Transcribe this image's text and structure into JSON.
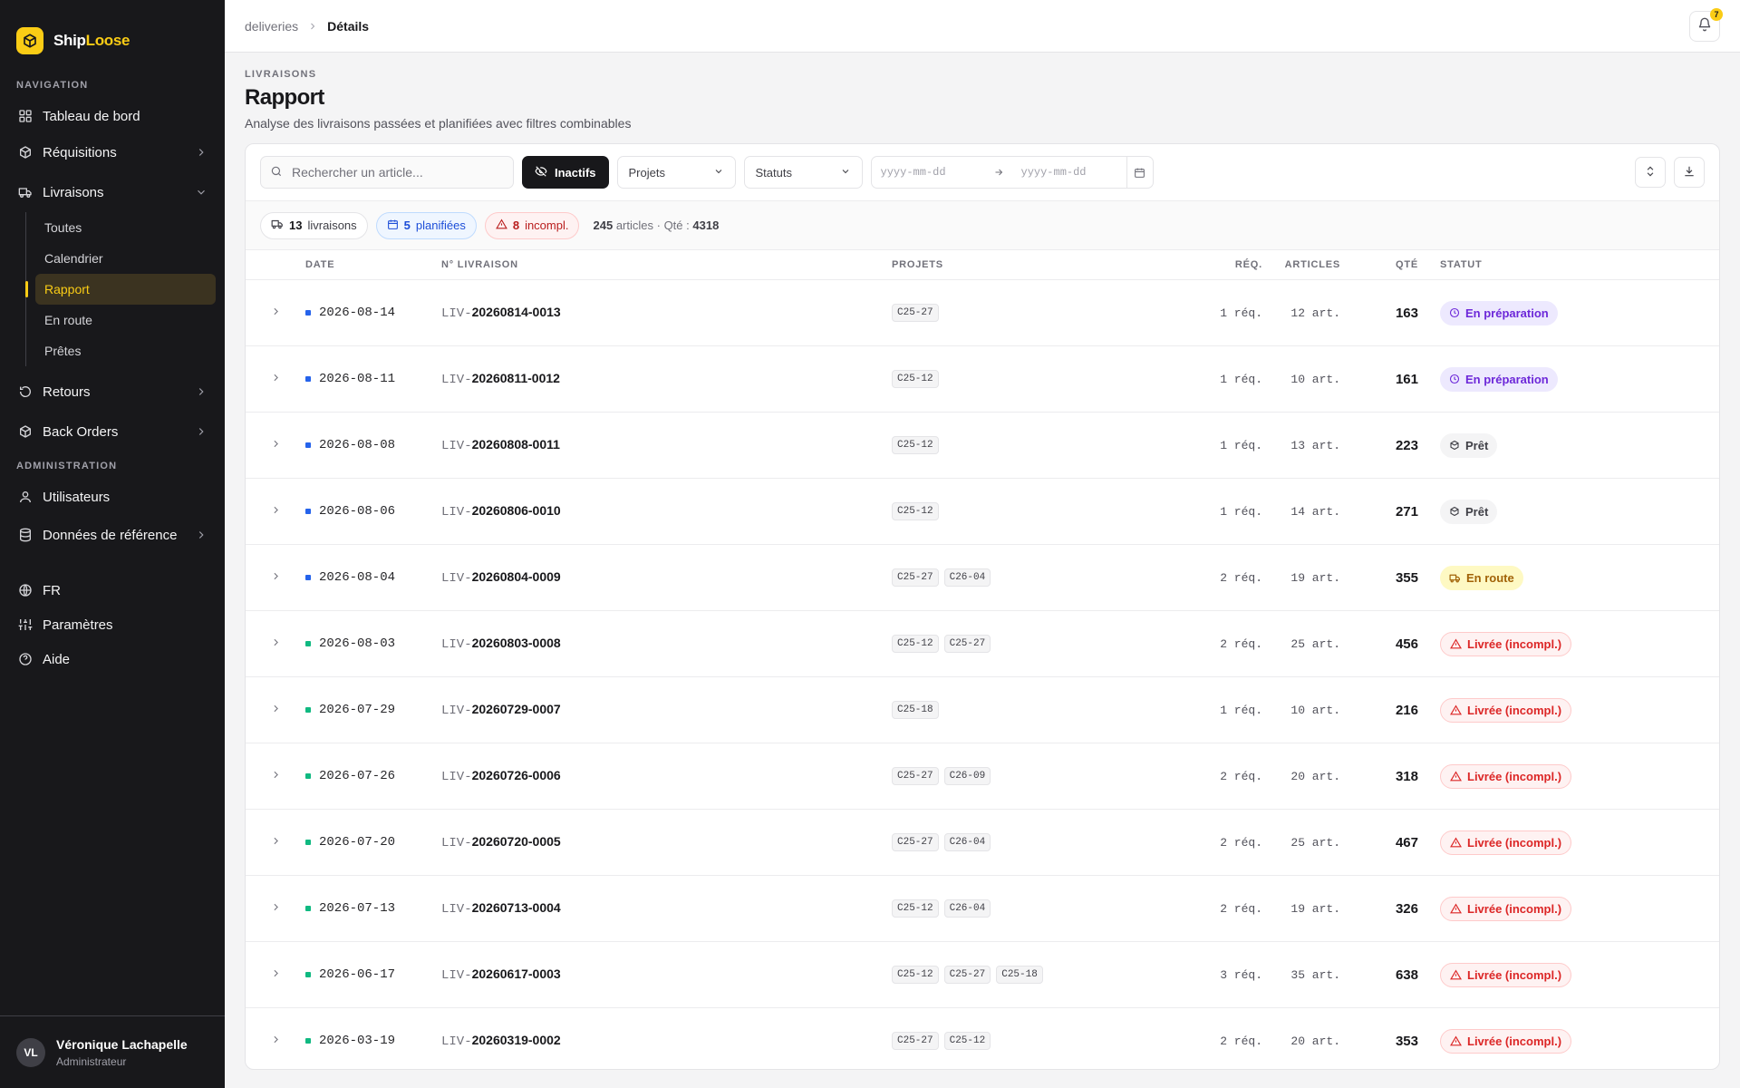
{
  "brand": {
    "name_part1": "Ship",
    "name_part2": "Loose"
  },
  "sidebar": {
    "nav_label": "NAVIGATION",
    "items": [
      {
        "label": "Tableau de bord"
      },
      {
        "label": "Réquisitions"
      },
      {
        "label": "Livraisons"
      }
    ],
    "livraisons_sub": [
      "Toutes",
      "Calendrier",
      "Rapport",
      "En route",
      "Prêtes"
    ],
    "items_after": [
      {
        "label": "Retours"
      },
      {
        "label": "Back Orders"
      }
    ],
    "admin_label": "ADMINISTRATION",
    "admin_items": [
      {
        "label": "Utilisateurs"
      },
      {
        "label": "Données de référence"
      }
    ],
    "bottom_items": [
      {
        "label": "FR"
      },
      {
        "label": "Paramètres"
      },
      {
        "label": "Aide"
      }
    ],
    "user": {
      "initials": "VL",
      "name": "Véronique Lachapelle",
      "role": "Administrateur"
    }
  },
  "topbar": {
    "breadcrumb_parent": "deliveries",
    "breadcrumb_current": "Détails",
    "notifications_count": "7"
  },
  "header": {
    "eyebrow": "LIVRAISONS",
    "title": "Rapport",
    "subtitle": "Analyse des livraisons passées et planifiées avec filtres combinables"
  },
  "toolbar": {
    "search_placeholder": "Rechercher un article...",
    "inactive_label": "Inactifs",
    "projects_label": "Projets",
    "status_label": "Statuts",
    "date_from_placeholder": "yyyy-mm-dd",
    "date_to_placeholder": "yyyy-mm-dd"
  },
  "stats": {
    "deliveries_count": "13",
    "deliveries_label": "livraisons",
    "planned_count": "5",
    "planned_label": "planifiées",
    "incomplete_count": "8",
    "incomplete_label": "incompl.",
    "articles_count": "245",
    "articles_label": "articles",
    "qty_label": "Qté :",
    "qty_value": "4318"
  },
  "table": {
    "headers": {
      "date": "DATE",
      "number": "N° LIVRAISON",
      "projects": "PROJETS",
      "req": "RÉQ.",
      "articles": "ARTICLES",
      "qty": "QTÉ",
      "status": "STATUT"
    },
    "rows": [
      {
        "date": "2026-08-14",
        "prefix": "LIV-",
        "id": "20260814-0013",
        "projects": [
          "C25-27"
        ],
        "req": "1 réq.",
        "articles": "12 art.",
        "qty": "163",
        "status": "En préparation",
        "kind": "prep",
        "planned": true
      },
      {
        "date": "2026-08-11",
        "prefix": "LIV-",
        "id": "20260811-0012",
        "projects": [
          "C25-12"
        ],
        "req": "1 réq.",
        "articles": "10 art.",
        "qty": "161",
        "status": "En préparation",
        "kind": "prep",
        "planned": true
      },
      {
        "date": "2026-08-08",
        "prefix": "LIV-",
        "id": "20260808-0011",
        "projects": [
          "C25-12"
        ],
        "req": "1 réq.",
        "articles": "13 art.",
        "qty": "223",
        "status": "Prêt",
        "kind": "pret",
        "planned": true
      },
      {
        "date": "2026-08-06",
        "prefix": "LIV-",
        "id": "20260806-0010",
        "projects": [
          "C25-12"
        ],
        "req": "1 réq.",
        "articles": "14 art.",
        "qty": "271",
        "status": "Prêt",
        "kind": "pret",
        "planned": true
      },
      {
        "date": "2026-08-04",
        "prefix": "LIV-",
        "id": "20260804-0009",
        "projects": [
          "C25-27",
          "C26-04"
        ],
        "req": "2 réq.",
        "articles": "19 art.",
        "qty": "355",
        "status": "En route",
        "kind": "route",
        "planned": true
      },
      {
        "date": "2026-08-03",
        "prefix": "LIV-",
        "id": "20260803-0008",
        "projects": [
          "C25-12",
          "C25-27"
        ],
        "req": "2 réq.",
        "articles": "25 art.",
        "qty": "456",
        "status": "Livrée (incompl.)",
        "kind": "inc",
        "planned": false
      },
      {
        "date": "2026-07-29",
        "prefix": "LIV-",
        "id": "20260729-0007",
        "projects": [
          "C25-18"
        ],
        "req": "1 réq.",
        "articles": "10 art.",
        "qty": "216",
        "status": "Livrée (incompl.)",
        "kind": "inc",
        "planned": false
      },
      {
        "date": "2026-07-26",
        "prefix": "LIV-",
        "id": "20260726-0006",
        "projects": [
          "C25-27",
          "C26-09"
        ],
        "req": "2 réq.",
        "articles": "20 art.",
        "qty": "318",
        "status": "Livrée (incompl.)",
        "kind": "inc",
        "planned": false
      },
      {
        "date": "2026-07-20",
        "prefix": "LIV-",
        "id": "20260720-0005",
        "projects": [
          "C25-27",
          "C26-04"
        ],
        "req": "2 réq.",
        "articles": "25 art.",
        "qty": "467",
        "status": "Livrée (incompl.)",
        "kind": "inc",
        "planned": false
      },
      {
        "date": "2026-07-13",
        "prefix": "LIV-",
        "id": "20260713-0004",
        "projects": [
          "C25-12",
          "C26-04"
        ],
        "req": "2 réq.",
        "articles": "19 art.",
        "qty": "326",
        "status": "Livrée (incompl.)",
        "kind": "inc",
        "planned": false
      },
      {
        "date": "2026-06-17",
        "prefix": "LIV-",
        "id": "20260617-0003",
        "projects": [
          "C25-12",
          "C25-27",
          "C25-18"
        ],
        "req": "3 réq.",
        "articles": "35 art.",
        "qty": "638",
        "status": "Livrée (incompl.)",
        "kind": "inc",
        "planned": false
      },
      {
        "date": "2026-03-19",
        "prefix": "LIV-",
        "id": "20260319-0002",
        "projects": [
          "C25-27",
          "C25-12"
        ],
        "req": "2 réq.",
        "articles": "20 art.",
        "qty": "353",
        "status": "Livrée (incompl.)",
        "kind": "inc",
        "planned": false
      }
    ]
  },
  "colors": {
    "accent": "#facc15",
    "planned_dot": "#2563eb",
    "delivered_dot": "#10b981",
    "sidebar_bg": "#18181b"
  }
}
